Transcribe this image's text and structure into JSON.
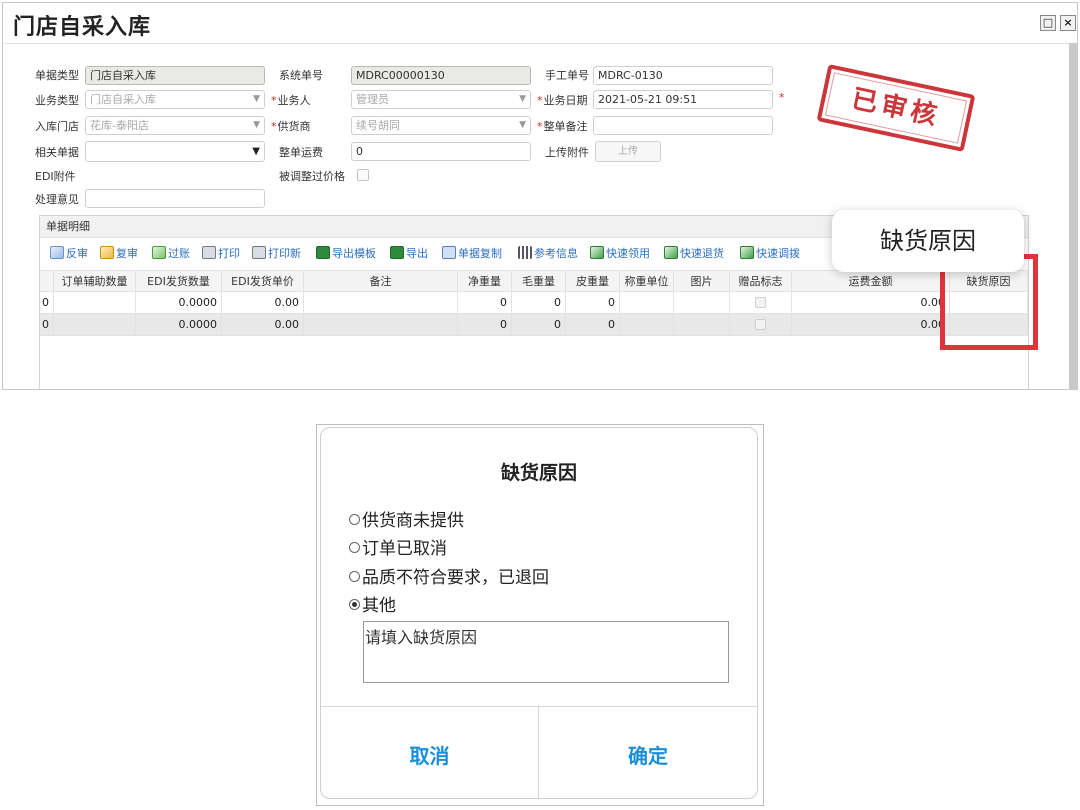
{
  "window": {
    "title": "门店自采入库",
    "restore_glyph": "□",
    "close_glyph": "×"
  },
  "form": {
    "doc_type_label": "单据类型",
    "doc_type_value": "门店自采入库",
    "biz_type_label": "业务类型",
    "biz_type_value": "门店自采入库",
    "store_label": "入库门店",
    "store_value": "花库-泰阳店",
    "related_doc_label": "相关单据",
    "related_doc_value": "",
    "edi_attach_label": "EDI附件",
    "opinion_label": "处理意见",
    "opinion_value": "",
    "sys_no_label": "系统单号",
    "sys_no_value": "MDRC00000130",
    "salesman_label": "业务人",
    "salesman_value": "管理员",
    "supplier_label": "供货商",
    "supplier_value": "续号胡同",
    "freight_label": "整单运费",
    "freight_value": "0",
    "price_adjusted_label": "被调整过价格",
    "manual_no_label": "手工单号",
    "manual_no_value": "MDRC-0130",
    "biz_date_label": "业务日期",
    "biz_date_value": "2021-05-21 09:51",
    "remark_label": "整单备注",
    "remark_value": "",
    "upload_label": "上传附件",
    "upload_button": "上传",
    "required_mark": "*"
  },
  "stamp": {
    "text": "已审核",
    "color": "#c8262a"
  },
  "detail": {
    "header": "单据明细",
    "toolbar": [
      {
        "label": "反审",
        "icon": "doc-icon"
      },
      {
        "label": "复审",
        "icon": "approve-icon"
      },
      {
        "label": "过账",
        "icon": "post-icon"
      },
      {
        "label": "打印",
        "icon": "printer-icon"
      },
      {
        "label": "打印新",
        "icon": "printer-icon"
      },
      {
        "label": "导出模板",
        "icon": "excel-icon"
      },
      {
        "label": "导出",
        "icon": "excel-icon"
      },
      {
        "label": "单据复制",
        "icon": "copy-icon"
      },
      {
        "label": "参考信息",
        "icon": "bars-icon"
      },
      {
        "label": "快速领用",
        "icon": "arrow-icon"
      },
      {
        "label": "快速退货",
        "icon": "arrow-icon"
      },
      {
        "label": "快速调拨",
        "icon": "arrow-icon"
      }
    ],
    "columns": [
      "订单辅助数量",
      "EDI发货数量",
      "EDI发货单价",
      "备注",
      "净重量",
      "毛重量",
      "皮重量",
      "称重单位",
      "图片",
      "赠品标志",
      "运费金额",
      "缺货原因"
    ],
    "rows": [
      {
        "lead": "0",
        "edi_qty": "0.0000",
        "edi_price": "0.00",
        "remark": "",
        "net": "0",
        "gross": "0",
        "tare": "0",
        "unit": "",
        "img": "",
        "freight": "0.00",
        "reason": ""
      },
      {
        "lead": "0",
        "edi_qty": "0.0000",
        "edi_price": "0.00",
        "remark": "",
        "net": "0",
        "gross": "0",
        "tare": "0",
        "unit": "",
        "img": "",
        "freight": "0.00",
        "reason": ""
      }
    ]
  },
  "callout": {
    "text": "缺货原因",
    "highlight_color": "#e0343c"
  },
  "dialog": {
    "title": "缺货原因",
    "options": [
      {
        "label": "供货商未提供",
        "selected": false
      },
      {
        "label": "订单已取消",
        "selected": false
      },
      {
        "label": "品质不符合要求，已退回",
        "selected": false
      },
      {
        "label": "其他",
        "selected": true
      }
    ],
    "reason_placeholder": "请填入缺货原因",
    "cancel_label": "取消",
    "confirm_label": "确定",
    "button_color": "#1a8fd8"
  }
}
